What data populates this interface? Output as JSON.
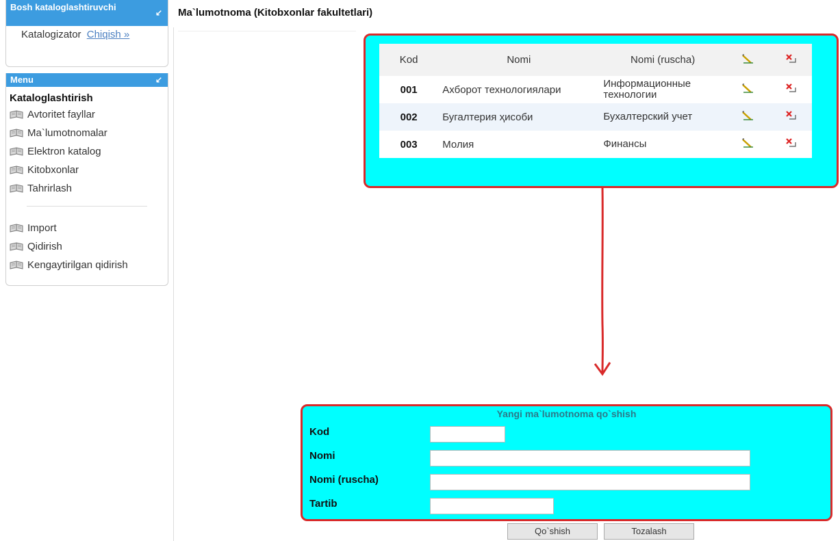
{
  "sidebar": {
    "header_title": "Bosh kataloglashtiruvchi",
    "user_role": "Katalogizator",
    "logout_label": "Chiqish »",
    "menu_header": "Menu",
    "section_title": "Kataloglashtirish",
    "items": [
      {
        "label": "Avtoritet fayllar",
        "icon": "book-icon"
      },
      {
        "label": "Ma`lumotnomalar",
        "icon": "book-icon"
      },
      {
        "label": "Elektron katalog",
        "icon": "book-icon"
      },
      {
        "label": "Kitobxonlar",
        "icon": "book-icon"
      },
      {
        "label": "Tahrirlash",
        "icon": "book-icon"
      }
    ],
    "items2": [
      {
        "label": "Import",
        "icon": "book-icon"
      },
      {
        "label": "Qidirish",
        "icon": "book-icon"
      },
      {
        "label": "Kengaytirilgan qidirish",
        "icon": "book-icon"
      }
    ]
  },
  "page": {
    "title": "Ma`lumotnoma (Kitobxonlar fakultetlari)"
  },
  "table": {
    "headers": [
      "Kod",
      "Nomi",
      "Nomi (ruscha)"
    ],
    "rows": [
      {
        "kod": "001",
        "nomi": "Ахборот технологиялари",
        "nomi_ru": "Информационные технологии"
      },
      {
        "kod": "002",
        "nomi": "Бугалтерия ҳисоби",
        "nomi_ru": "Бухалтерский учет"
      },
      {
        "kod": "003",
        "nomi": "Молия",
        "nomi_ru": "Финансы"
      }
    ]
  },
  "form": {
    "title": "Yangi ma`lumotnoma qo`shish",
    "fields": [
      {
        "label": "Kod",
        "value": ""
      },
      {
        "label": "Nomi",
        "value": ""
      },
      {
        "label": "Nomi (ruscha)",
        "value": ""
      },
      {
        "label": "Tartib",
        "value": ""
      }
    ],
    "add_label": "Qo`shish",
    "clear_label": "Tozalash"
  },
  "colors": {
    "accent": "#3c9ce0",
    "highlight": "#00ffff",
    "callout_border": "#d92a2a"
  }
}
